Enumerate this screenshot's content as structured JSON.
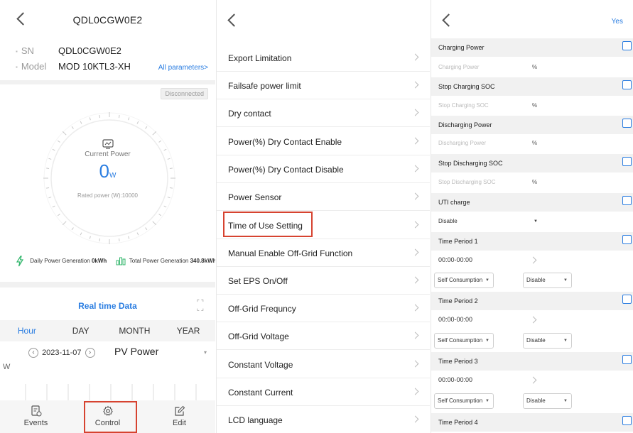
{
  "device": {
    "title": "QDL0CGW0E2",
    "sn_label": "SN",
    "sn_value": "QDL0CGW0E2",
    "model_label": "Model",
    "model_value": "MOD 10KTL3-XH",
    "all_params": "All parameters>",
    "status": "Disconnected",
    "current_power_label": "Current Power",
    "current_power_value": "0",
    "current_power_unit": "W",
    "rated_power": "Rated power (W):10000",
    "daily_gen_label": "Daily Power Generation",
    "daily_gen_value": "0kWh",
    "total_gen_label": "Total Power Generation",
    "total_gen_value": "340.8kWh",
    "realtime_title": "Real time Data",
    "tabs": [
      "Hour",
      "DAY",
      "MONTH",
      "YEAR"
    ],
    "date": "2023-11-07",
    "metric": "PV Power",
    "y_unit": "W",
    "nav": [
      {
        "label": "Events",
        "icon": "events-icon"
      },
      {
        "label": "Control",
        "icon": "gear-icon"
      },
      {
        "label": "Edit",
        "icon": "edit-icon"
      }
    ]
  },
  "menu": {
    "items": [
      "Export Limitation",
      "Failsafe power limit",
      "Dry contact",
      "Power(%) Dry Contact Enable",
      "Power(%) Dry Contact Disable",
      "Power Sensor",
      "Time of Use Setting",
      "Manual Enable Off-Grid Function",
      "Set EPS On/Off",
      "Off-Grid Frequncy",
      "Off-Grid Voltage",
      "Constant Voltage",
      "Constant Current",
      "LCD language"
    ]
  },
  "tou": {
    "confirm": "Yes",
    "charging_power": {
      "label": "Charging Power",
      "placeholder": "Charging Power",
      "unit": "%"
    },
    "stop_charging": {
      "label": "Stop Charging SOC",
      "placeholder": "Stop Charging SOC",
      "unit": "%"
    },
    "discharging_power": {
      "label": "Discharging Power",
      "placeholder": "Discharging Power",
      "unit": "%"
    },
    "stop_discharging": {
      "label": "Stop Discharging SOC",
      "placeholder": "Stop Discharging SOC",
      "unit": "%"
    },
    "uti": {
      "label": "UTI charge",
      "value": "Disable"
    },
    "periods": [
      {
        "label": "Time Period 1",
        "time": "00:00-00:00",
        "mode": "Self Consumption",
        "state": "Disable"
      },
      {
        "label": "Time Period 2",
        "time": "00:00-00:00",
        "mode": "Self Consumption",
        "state": "Disable"
      },
      {
        "label": "Time Period 3",
        "time": "00:00-00:00",
        "mode": "Self Consumption",
        "state": "Disable"
      },
      {
        "label": "Time Period 4"
      }
    ]
  }
}
